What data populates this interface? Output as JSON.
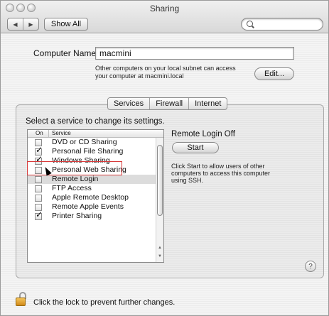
{
  "window": {
    "title": "Sharing"
  },
  "toolbar": {
    "back_icon": "back-arrow-icon",
    "forward_icon": "forward-arrow-icon",
    "show_all_label": "Show All",
    "search_icon": "search-icon",
    "search_value": ""
  },
  "computer_name": {
    "label": "Computer Name:",
    "value": "macmini",
    "note": "Other computers on your local subnet can access your computer at macmini.local",
    "edit_label": "Edit..."
  },
  "tabs": [
    {
      "label": "Services",
      "active": true
    },
    {
      "label": "Firewall",
      "active": false
    },
    {
      "label": "Internet",
      "active": false
    }
  ],
  "services_panel": {
    "instruction": "Select a service to change its settings.",
    "columns": {
      "on": "On",
      "service": "Service"
    },
    "items": [
      {
        "name": "DVD or CD Sharing",
        "on": false,
        "selected": false
      },
      {
        "name": "Personal File Sharing",
        "on": true,
        "selected": false
      },
      {
        "name": "Windows Sharing",
        "on": true,
        "selected": false
      },
      {
        "name": "Personal Web Sharing",
        "on": false,
        "selected": false
      },
      {
        "name": "Remote Login",
        "on": false,
        "selected": true
      },
      {
        "name": "FTP Access",
        "on": false,
        "selected": false
      },
      {
        "name": "Apple Remote Desktop",
        "on": false,
        "selected": false
      },
      {
        "name": "Remote Apple Events",
        "on": false,
        "selected": false
      },
      {
        "name": "Printer Sharing",
        "on": true,
        "selected": false
      }
    ]
  },
  "detail": {
    "status": "Remote Login Off",
    "start_label": "Start",
    "description": "Click Start to allow users of other computers to access this computer using SSH."
  },
  "help_label": "?",
  "footer": {
    "lock_icon": "lock-open-icon",
    "text": "Click the lock to prevent further changes."
  }
}
